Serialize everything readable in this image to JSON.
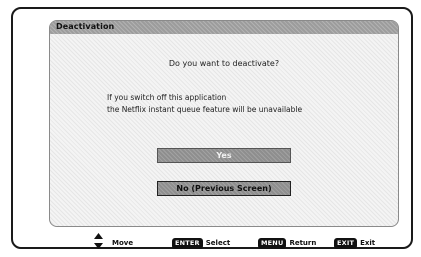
{
  "dialog": {
    "title": "Deactivation",
    "question": "Do you want to deactivate?",
    "info_line_1": "If you switch off this application",
    "info_line_2": "the Netflix instant queue feature will be unavailable",
    "yes_label": "Yes",
    "no_label": "No (Previous Screen)"
  },
  "footer": {
    "move_label": "Move",
    "enter_key": "ENTER",
    "select_label": "Select",
    "menu_key": "MENU",
    "return_label": "Return",
    "exit_key": "EXIT",
    "exit_label": "Exit"
  }
}
